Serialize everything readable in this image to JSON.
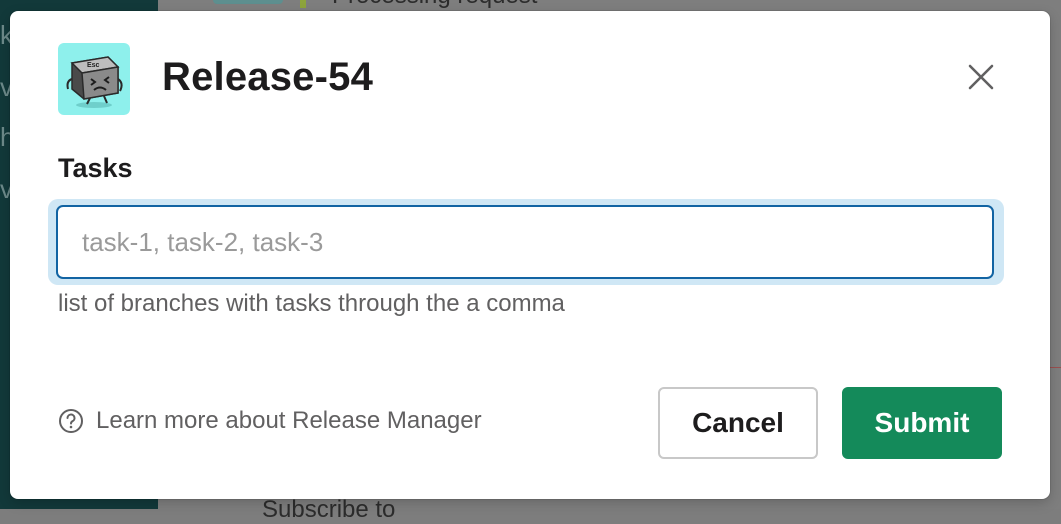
{
  "background": {
    "sidebar_fragments": [
      "k",
      "v",
      "h",
      "v"
    ],
    "top_text": "Processing request",
    "bottom_text": "Subscribe to"
  },
  "modal": {
    "title": "Release-54",
    "app_icon": "esc-key-mascot-icon",
    "app_icon_key_label": "Esc",
    "close_icon": "close-icon",
    "field": {
      "label": "Tasks",
      "value": "",
      "placeholder": "task-1, task-2, task-3",
      "hint": "list of branches with tasks through the a comma"
    },
    "footer": {
      "help_icon": "question-circle-icon",
      "learn_more": "Learn more about Release Manager",
      "cancel_label": "Cancel",
      "submit_label": "Submit"
    }
  },
  "colors": {
    "primary": "#148a5a",
    "focus_border": "#1264a3",
    "focus_ring": "#cfe7f5",
    "app_icon_bg": "#8ef0ec"
  }
}
